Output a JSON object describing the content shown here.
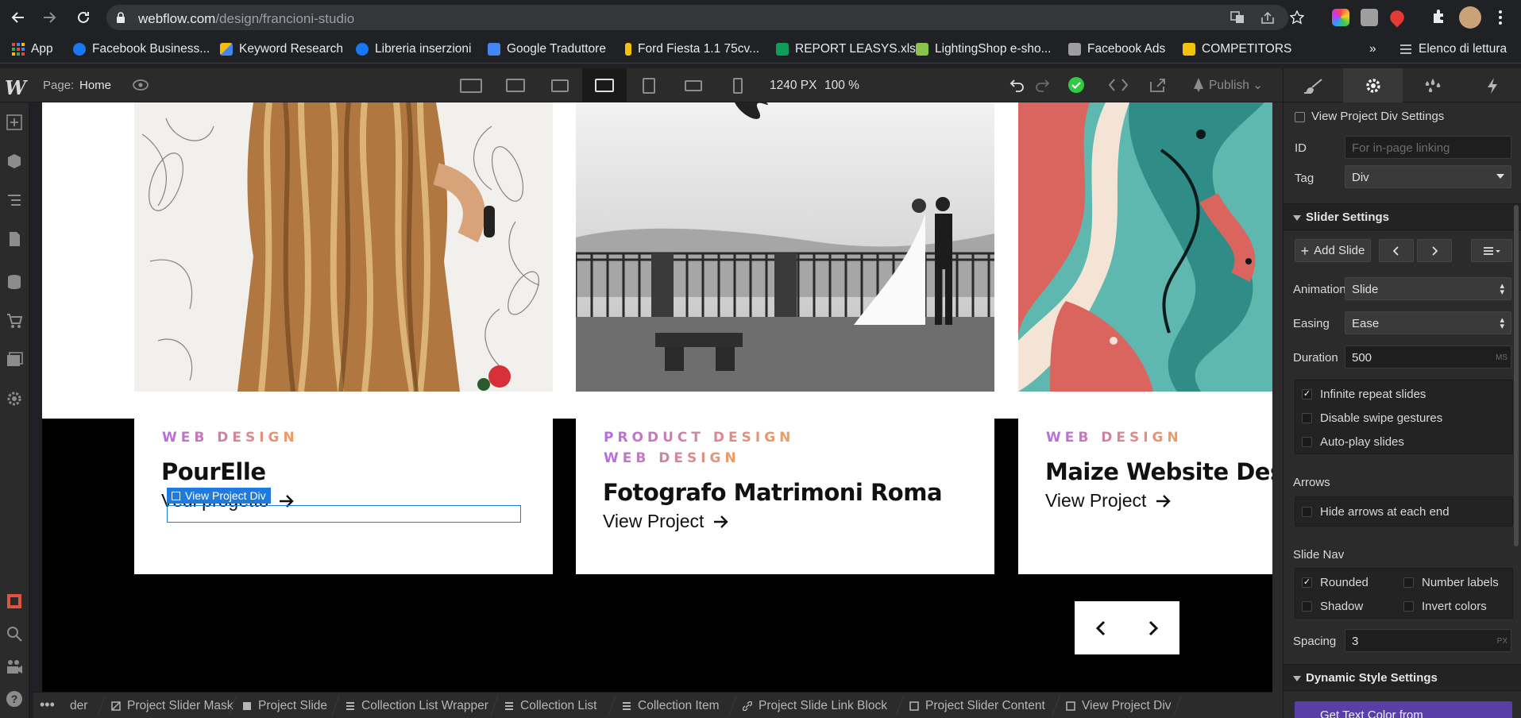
{
  "browser": {
    "url_host": "webflow.com",
    "url_path": "/design/francioni-studio"
  },
  "bookmarks": [
    {
      "label": "App",
      "icon": "apps-grid-icon",
      "color": "#e8453c"
    },
    {
      "label": "Facebook Business...",
      "icon": "meta-icon",
      "color": "#1877f2"
    },
    {
      "label": "Keyword Research",
      "icon": "google-ads-icon",
      "color": "#fbbc04"
    },
    {
      "label": "Libreria inserzioni",
      "icon": "meta-icon",
      "color": "#1877f2"
    },
    {
      "label": "Google Traduttore",
      "icon": "translate-icon",
      "color": "#4285f4"
    },
    {
      "label": "Ford Fiesta 1.1 75cv...",
      "icon": "bookmark-yellow-icon",
      "color": "#f4c20d"
    },
    {
      "label": "REPORT LEASYS.xls",
      "icon": "sheets-icon",
      "color": "#0f9d58"
    },
    {
      "label": "LightingShop e-sho...",
      "icon": "shop-icon",
      "color": "#8bc34a"
    },
    {
      "label": "Facebook Ads",
      "icon": "page-icon",
      "color": "#9e9e9e"
    },
    {
      "label": "COMPETITORS",
      "icon": "folder-icon",
      "color": "#f4c20d"
    }
  ],
  "bookmarks_more": "»",
  "reading_list": "Elenco di lettura",
  "designer": {
    "page_label": "Page:",
    "page_name": "Home",
    "canvas_width": "1240 PX",
    "zoom": "100 %",
    "publish_label": "Publish"
  },
  "cards": [
    {
      "tags": [
        "WEB DESIGN"
      ],
      "title": "PourElle",
      "link": "Vedi progetto"
    },
    {
      "tags": [
        "PRODUCT DESIGN",
        "WEB DESIGN"
      ],
      "title": "Fotografo Matrimoni Roma",
      "link": "View Project"
    },
    {
      "tags": [
        "WEB DESIGN"
      ],
      "title": "Maize Website Design",
      "link": "View Project"
    }
  ],
  "selection_badge": "View Project Div",
  "breadcrumbs": [
    "der",
    "Project Slider Mask",
    "Project Slide",
    "Collection List Wrapper",
    "Collection List",
    "Collection Item",
    "Project Slide Link Block",
    "Project Slider Content",
    "View Project Div"
  ],
  "settings": {
    "header": "View Project Div Settings",
    "id_label": "ID",
    "id_placeholder": "For in-page linking",
    "tag_label": "Tag",
    "tag_value": "Div",
    "slider_section": "Slider Settings",
    "add_slide": "Add Slide",
    "animation_label": "Animation",
    "animation_value": "Slide",
    "easing_label": "Easing",
    "easing_value": "Ease",
    "duration_label": "Duration",
    "duration_value": "500",
    "duration_unit": "MS",
    "infinite_repeat": {
      "label": "Infinite repeat slides",
      "checked": true
    },
    "disable_swipe": {
      "label": "Disable swipe gestures",
      "checked": false
    },
    "autoplay": {
      "label": "Auto-play slides",
      "checked": false
    },
    "arrows_label": "Arrows",
    "hide_arrows": {
      "label": "Hide arrows at each end",
      "checked": false
    },
    "slide_nav_label": "Slide Nav",
    "rounded": {
      "label": "Rounded",
      "checked": true
    },
    "number_labels": {
      "label": "Number labels",
      "checked": false
    },
    "shadow": {
      "label": "Shadow",
      "checked": false
    },
    "invert_colors": {
      "label": "Invert colors",
      "checked": false
    },
    "spacing_label": "Spacing",
    "spacing_value": "3",
    "spacing_unit": "PX",
    "dynamic_section": "Dynamic Style Settings",
    "dynamic_partial": "Get Text Color from"
  },
  "colors": {
    "selection": "#1f7ae0",
    "tag_gradient_start": "#b46ce0",
    "tag_gradient_end": "#f39c5a",
    "publish_check": "#2ecc40"
  }
}
